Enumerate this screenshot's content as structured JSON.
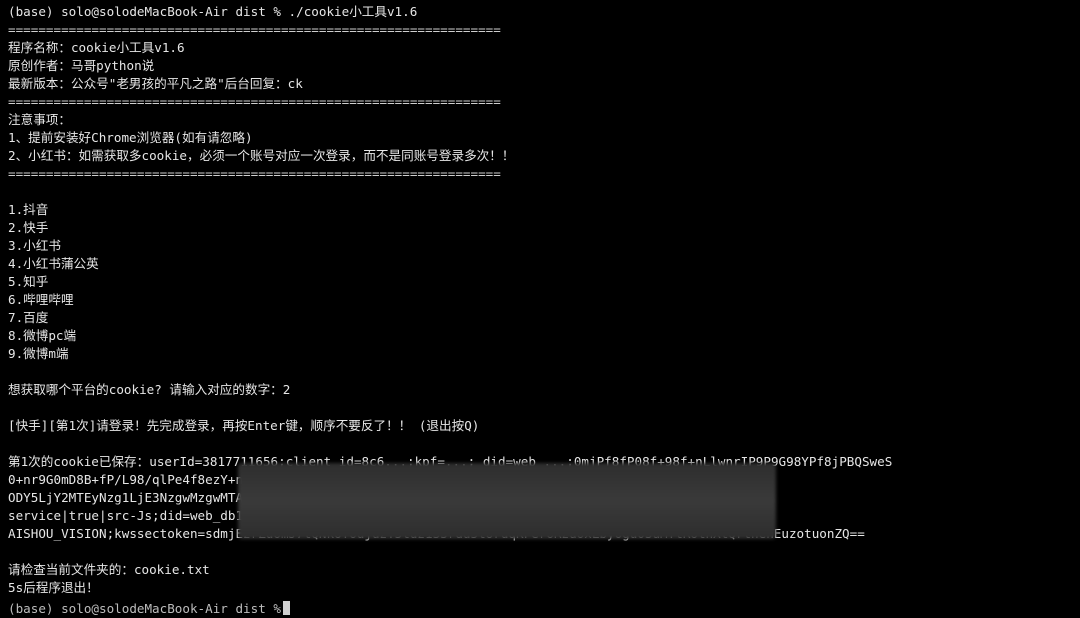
{
  "prompt_line": "(base) solo@solodeMacBook-Air dist % ./cookie小工具v1.6",
  "rule": "=================================================================",
  "info": {
    "name": "程序名称：cookie小工具v1.6",
    "author": "原创作者：马哥python说",
    "latest": "最新版本：公众号\"老男孩的平凡之路\"后台回复：ck"
  },
  "notes": {
    "title": "注意事项：",
    "items": [
      "1、提前安装好Chrome浏览器(如有请忽略)",
      "2、小红书：如需获取多cookie，必须一个账号对应一次登录，而不是同账号登录多次！！"
    ]
  },
  "menu": [
    "1.抖音",
    "2.快手",
    "3.小红书",
    "4.小红书蒲公英",
    "5.知乎",
    "6.哔哩哔哩",
    "7.百度",
    "8.微博pc端",
    "9.微博m端"
  ],
  "question": "想获取哪个平台的cookie? 请输入对应的数字：2",
  "login_prompt": "[快手][第1次]请登录！先完成登录，再按Enter键，顺序不要反了！！ (退出按Q)",
  "saved": {
    "line1": "第1次的cookie已保存：userId=3817711656;client_id=8c6...;kpf=...;_did=web_...;0mjPf8fP08f+98f+nLlwnrIP9P9G98YPf8jPBQSweS",
    "line2": "0+nr9G0mD8B+fP/L98/qlPe4f8ezY+n...P0G=;ktrace-context=1|MS44Nzg0NzI0NTc4Nzk2",
    "line3": "ODY5LjY2MTEyNzg1LjE3NzgwMzgwMTA...NTkwMTQ1|0|webservice-user-growth-node|web",
    "line4": "service|true|src-Js;did=web_db1...91ff54d9d87d4f7275af2c0d9971cececea;kpn=KU",
    "line5": "AISHOU_VISION;kwssectoken=sdmjEzrZuomJ7tQNk6ToujuzT5tdz133rdu5tUrdqKFeroRzuoxLbyogu03uMTtRothXtQrthenEuzotuonZQ=="
  },
  "check_file": "请检查当前文件夹的：cookie.txt",
  "exit_msg": "5s后程序退出！",
  "partial_next": "(base) solo@solodeMacBook-Air dist %"
}
